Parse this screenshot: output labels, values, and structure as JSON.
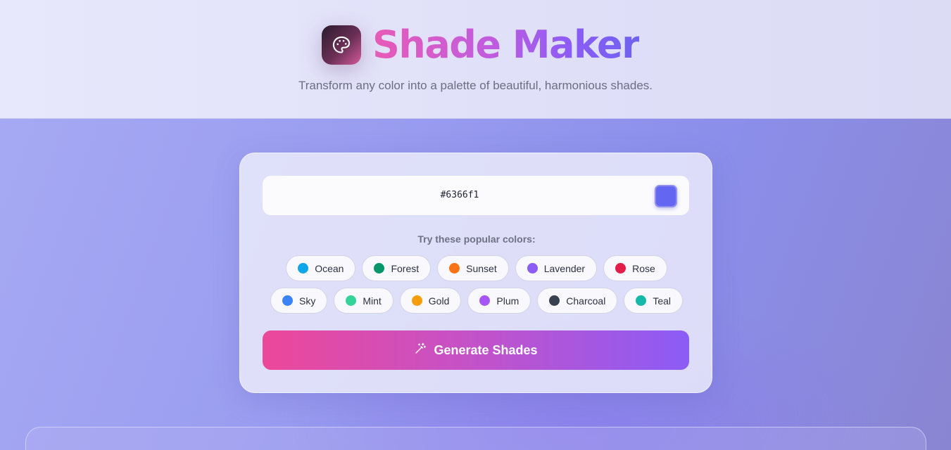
{
  "header": {
    "title": "Shade Maker",
    "subtitle": "Transform any color into a palette of beautiful, harmonious shades.",
    "logo_icon": "palette-icon"
  },
  "input": {
    "hex_value": "#6366f1",
    "swatch_color": "#6366f1"
  },
  "presets": {
    "label": "Try these popular colors:",
    "row1": [
      {
        "name": "Ocean",
        "color": "#0ea5e9"
      },
      {
        "name": "Forest",
        "color": "#059669"
      },
      {
        "name": "Sunset",
        "color": "#f97316"
      },
      {
        "name": "Lavender",
        "color": "#8b5cf6"
      },
      {
        "name": "Rose",
        "color": "#e11d48"
      }
    ],
    "row2": [
      {
        "name": "Sky",
        "color": "#3b82f6"
      },
      {
        "name": "Mint",
        "color": "#34d399"
      },
      {
        "name": "Gold",
        "color": "#f59e0b"
      },
      {
        "name": "Plum",
        "color": "#a855f7"
      },
      {
        "name": "Charcoal",
        "color": "#374151"
      },
      {
        "name": "Teal",
        "color": "#14b8a6"
      }
    ]
  },
  "generate": {
    "label": "Generate Shades",
    "icon": "magic-wand-icon"
  }
}
